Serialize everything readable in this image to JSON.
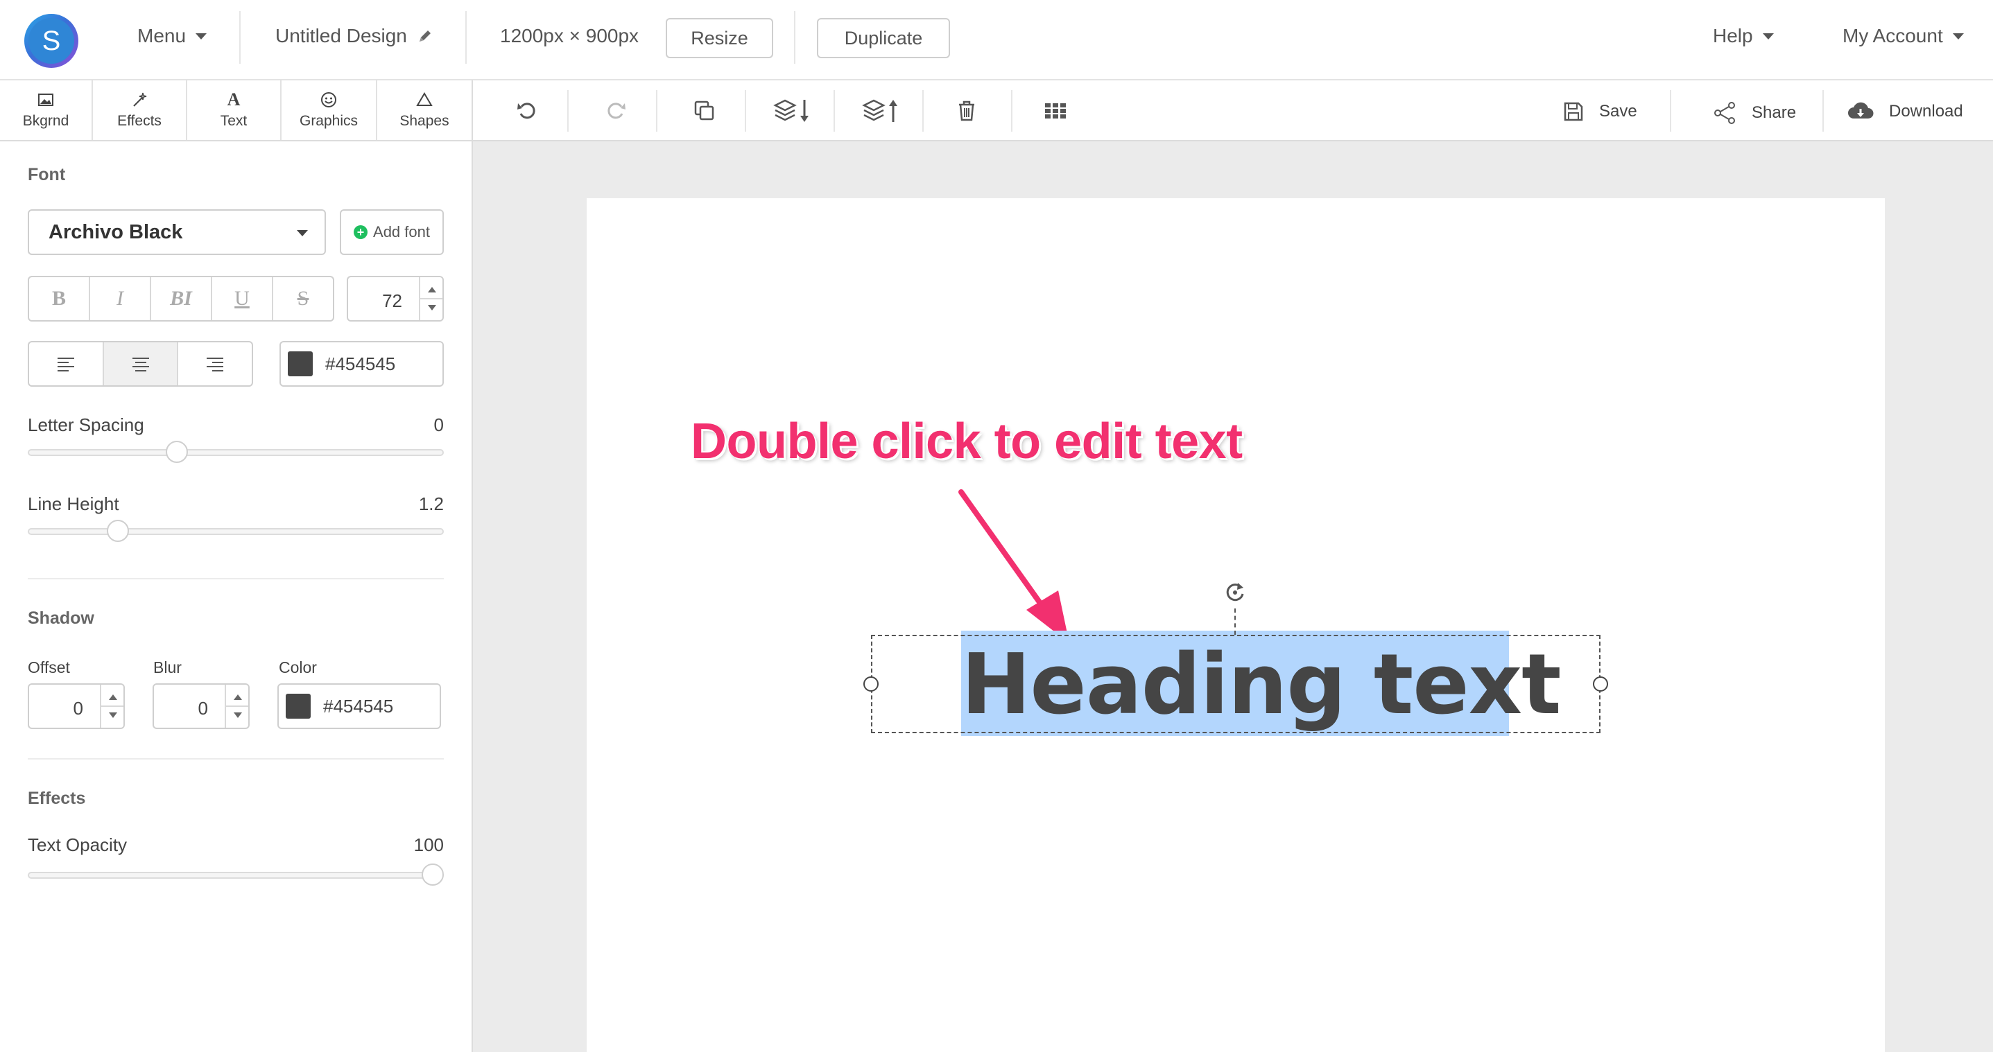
{
  "topbar": {
    "logo_letter": "S",
    "menu_label": "Menu",
    "design_title": "Untitled Design",
    "dimensions": "1200px × 900px",
    "resize_label": "Resize",
    "duplicate_label": "Duplicate",
    "help_label": "Help",
    "account_label": "My Account"
  },
  "tabs": [
    {
      "label": "Bkgrnd",
      "icon": "image-icon"
    },
    {
      "label": "Effects",
      "icon": "magic-wand-icon"
    },
    {
      "label": "Text",
      "icon": "text-icon"
    },
    {
      "label": "Graphics",
      "icon": "smiley-icon"
    },
    {
      "label": "Shapes",
      "icon": "triangle-icon"
    }
  ],
  "font": {
    "section_title": "Font",
    "family": "Archivo Black",
    "add_font_label": "Add font",
    "styles": [
      "B",
      "I",
      "BI",
      "U",
      "S"
    ],
    "size": "72",
    "color": "#454545",
    "letter_spacing_label": "Letter Spacing",
    "letter_spacing_value": "0",
    "letter_spacing_level": 0.35,
    "line_height_label": "Line Height",
    "line_height_value": "1.2",
    "line_height_level": 0.2
  },
  "shadow": {
    "section_title": "Shadow",
    "offset_label": "Offset",
    "offset_value": "0",
    "blur_label": "Blur",
    "blur_value": "0",
    "color_label": "Color",
    "color_value": "#454545"
  },
  "effects": {
    "section_title": "Effects",
    "opacity_label": "Text Opacity",
    "opacity_value": "100",
    "opacity_level": 1.0
  },
  "toolbar": {
    "save_label": "Save",
    "share_label": "Share",
    "download_label": "Download"
  },
  "canvas": {
    "hint_text": "Double click to edit text",
    "heading_text": "Heading text",
    "hint_color": "#f2306f",
    "selection_color": "#b3d6fd"
  }
}
